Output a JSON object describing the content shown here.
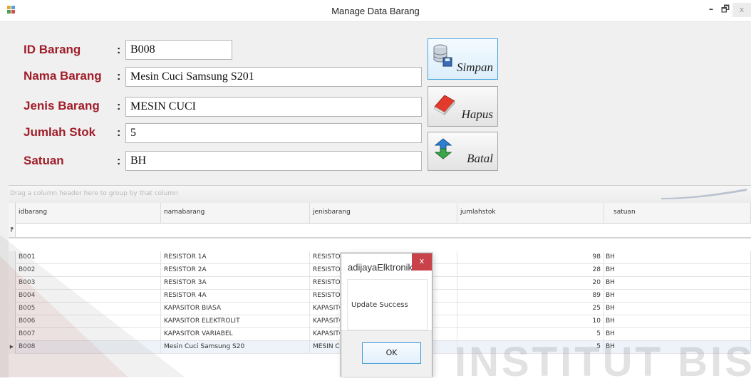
{
  "window": {
    "title": "Manage Data Barang",
    "controls": {
      "minimize": "–",
      "maximize": "🗗",
      "close": "x"
    }
  },
  "form": {
    "separator": ":",
    "fields": [
      {
        "label": "ID Barang",
        "value": "B008"
      },
      {
        "label": "Nama Barang",
        "value": "Mesin Cuci Samsung S201"
      },
      {
        "label": "Jenis Barang",
        "value": "MESIN CUCI"
      },
      {
        "label": "Jumlah Stok",
        "value": "5"
      },
      {
        "label": "Satuan",
        "value": "BH"
      }
    ]
  },
  "actions": {
    "save": {
      "label": "Simpan",
      "icon": "database-save-icon"
    },
    "delete": {
      "label": "Hapus",
      "icon": "eraser-icon"
    },
    "cancel": {
      "label": "Batal",
      "icon": "refresh-arrows-icon"
    }
  },
  "grid": {
    "group_hint": "Drag a column header here to group by that column",
    "new_row_marker": "⁋",
    "selected_marker": "▶",
    "columns": [
      "idbarang",
      "namabarang",
      "jenisbarang",
      "jumlahstok",
      "satuan"
    ],
    "rows": [
      {
        "idbarang": "B001",
        "namabarang": "RESISTOR 1A",
        "jenisbarang": "RESISTOR",
        "jumlahstok": "98",
        "satuan": "BH"
      },
      {
        "idbarang": "B002",
        "namabarang": "RESISTOR 2A",
        "jenisbarang": "RESISTOR",
        "jumlahstok": "28",
        "satuan": "BH"
      },
      {
        "idbarang": "B003",
        "namabarang": "RESISTOR 3A",
        "jenisbarang": "RESISTOR",
        "jumlahstok": "20",
        "satuan": "BH"
      },
      {
        "idbarang": "B004",
        "namabarang": "RESISTOR 4A",
        "jenisbarang": "RESISTOR",
        "jumlahstok": "89",
        "satuan": "BH"
      },
      {
        "idbarang": "B005",
        "namabarang": "KAPASITOR BIASA",
        "jenisbarang": "KAPASITO",
        "jumlahstok": "25",
        "satuan": "BH"
      },
      {
        "idbarang": "B006",
        "namabarang": "KAPASITOR ELEKTROLIT",
        "jenisbarang": "KAPASITO",
        "jumlahstok": "10",
        "satuan": "BH"
      },
      {
        "idbarang": "B007",
        "namabarang": "KAPASITOR VARIABEL",
        "jenisbarang": "KAPASITO",
        "jumlahstok": "5",
        "satuan": "BH"
      },
      {
        "idbarang": "B008",
        "namabarang": "Mesin Cuci Samsung S20",
        "jenisbarang": "MESIN CU",
        "jumlahstok": "5",
        "satuan": "BH"
      }
    ],
    "selected_index": 7
  },
  "dialog": {
    "title": "adijayaElktronik",
    "message": "Update Success",
    "ok_label": "OK",
    "close_label": "x"
  },
  "watermark": {
    "text": "INSTITUT BISNIS"
  },
  "colors": {
    "label_red": "#a01e2a",
    "focus_blue": "#4aa3df",
    "close_red": "#c9424a"
  }
}
